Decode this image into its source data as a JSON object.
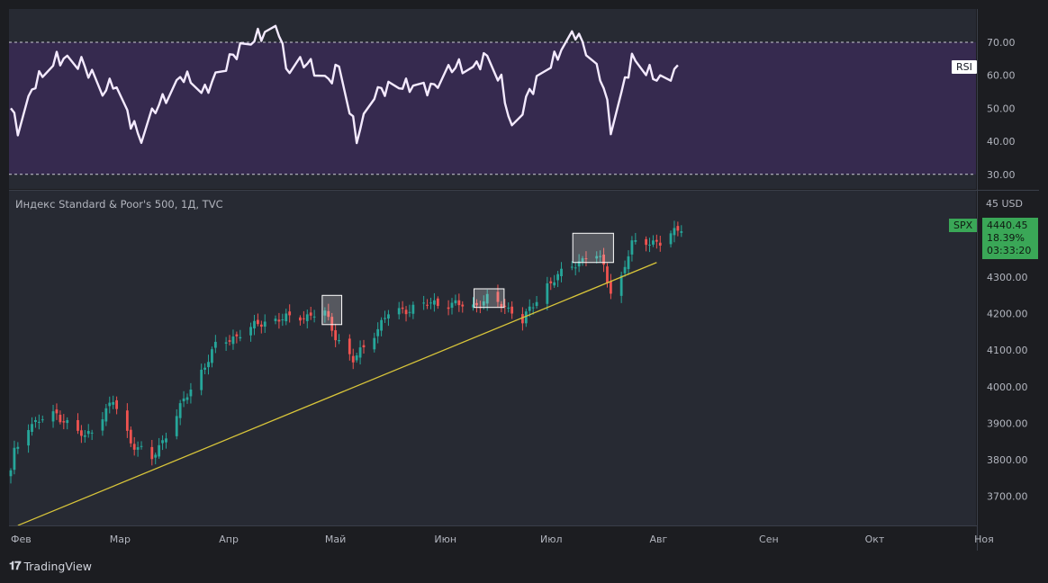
{
  "rsi_pane": {
    "tag": "RSI",
    "ticks": [
      "70.00",
      "60.00",
      "50.00",
      "40.00",
      "30.00"
    ],
    "levels": [
      70,
      30
    ],
    "ylim": [
      25,
      80
    ]
  },
  "price_pane": {
    "title": "Индекс Standard & Poor's 500, 1Д, TVC",
    "currency": "45 USD",
    "ticks": [
      "4300.00",
      "4200.00",
      "4100.00",
      "4000.00",
      "3900.00",
      "3800.00",
      "3700.00"
    ],
    "symbol": "SPX",
    "last_price": "4440.45",
    "change": "18.39%",
    "countdown": "03:33:20"
  },
  "x_axis": {
    "labels": [
      "Фев",
      "Мар",
      "Апр",
      "Май",
      "Июн",
      "Июл",
      "Авг",
      "Сен",
      "Окт",
      "Ноя"
    ]
  },
  "brand": "TradingView",
  "colors": {
    "background": "#1c1d21",
    "pane": "#272a33",
    "rsi_band": "#362a4f",
    "rsi_line": "#f4eaff",
    "up": "#26a69a",
    "down": "#ef5350",
    "trendline": "#d8c53a",
    "price_tag": "#3aa757"
  },
  "chart_data": {
    "type": "candlestick",
    "title": "Индекс Standard & Poor's 500, 1Д, TVC",
    "y_unit": "USD",
    "ylim": [
      3620,
      4470
    ],
    "anchors": [
      {
        "date": "2023-02-01",
        "close": 3765
      },
      {
        "date": "2023-02-02",
        "close": 3820
      },
      {
        "date": "2023-02-06",
        "close": 3895
      },
      {
        "date": "2023-02-14",
        "close": 3925
      },
      {
        "date": "2023-02-22",
        "close": 3860
      },
      {
        "date": "2023-03-02",
        "close": 3960
      },
      {
        "date": "2023-03-07",
        "close": 3850
      },
      {
        "date": "2023-03-13",
        "close": 3800
      },
      {
        "date": "2023-03-22",
        "close": 3960
      },
      {
        "date": "2023-03-31",
        "close": 4110
      },
      {
        "date": "2023-04-14",
        "close": 4180
      },
      {
        "date": "2023-05-01",
        "close": 4200
      },
      {
        "date": "2023-05-04",
        "close": 4140
      },
      {
        "date": "2023-05-09",
        "close": 4070
      },
      {
        "date": "2023-05-19",
        "close": 4200
      },
      {
        "date": "2023-06-01",
        "close": 4230
      },
      {
        "date": "2023-06-12",
        "close": 4220
      },
      {
        "date": "2023-06-16",
        "close": 4240
      },
      {
        "date": "2023-06-23",
        "close": 4210
      },
      {
        "date": "2023-06-26",
        "close": 4180
      },
      {
        "date": "2023-07-03",
        "close": 4280
      },
      {
        "date": "2023-07-10",
        "close": 4330
      },
      {
        "date": "2023-07-16",
        "close": 4370
      },
      {
        "date": "2023-07-19",
        "close": 4330
      },
      {
        "date": "2023-07-21",
        "close": 4260
      },
      {
        "date": "2023-07-24",
        "close": 4300
      },
      {
        "date": "2023-07-27",
        "close": 4390
      },
      {
        "date": "2023-08-01",
        "close": 4400
      },
      {
        "date": "2023-08-04",
        "close": 4390
      },
      {
        "date": "2023-08-10",
        "close": 4440
      }
    ],
    "rsi_anchors": [
      {
        "date": "2023-02-01",
        "rsi": 50
      },
      {
        "date": "2023-02-03",
        "rsi": 44
      },
      {
        "date": "2023-02-08",
        "rsi": 58
      },
      {
        "date": "2023-02-14",
        "rsi": 65
      },
      {
        "date": "2023-02-21",
        "rsi": 64
      },
      {
        "date": "2023-02-27",
        "rsi": 55
      },
      {
        "date": "2023-03-02",
        "rsi": 58
      },
      {
        "date": "2023-03-07",
        "rsi": 46
      },
      {
        "date": "2023-03-10",
        "rsi": 41
      },
      {
        "date": "2023-03-14",
        "rsi": 50
      },
      {
        "date": "2023-03-22",
        "rsi": 60
      },
      {
        "date": "2023-03-28",
        "rsi": 55
      },
      {
        "date": "2023-04-04",
        "rsi": 65
      },
      {
        "date": "2023-04-12",
        "rsi": 72
      },
      {
        "date": "2023-04-18",
        "rsi": 74
      },
      {
        "date": "2023-04-20",
        "rsi": 62
      },
      {
        "date": "2023-04-26",
        "rsi": 64
      },
      {
        "date": "2023-05-02",
        "rsi": 58
      },
      {
        "date": "2023-05-05",
        "rsi": 63
      },
      {
        "date": "2023-05-10",
        "rsi": 41
      },
      {
        "date": "2023-05-15",
        "rsi": 55
      },
      {
        "date": "2023-05-23",
        "rsi": 57
      },
      {
        "date": "2023-05-31",
        "rsi": 56
      },
      {
        "date": "2023-06-07",
        "rsi": 63
      },
      {
        "date": "2023-06-12",
        "rsi": 62
      },
      {
        "date": "2023-06-16",
        "rsi": 66
      },
      {
        "date": "2023-06-20",
        "rsi": 58
      },
      {
        "date": "2023-06-23",
        "rsi": 43
      },
      {
        "date": "2023-06-28",
        "rsi": 55
      },
      {
        "date": "2023-07-05",
        "rsi": 65
      },
      {
        "date": "2023-07-11",
        "rsi": 73
      },
      {
        "date": "2023-07-14",
        "rsi": 68
      },
      {
        "date": "2023-07-19",
        "rsi": 57
      },
      {
        "date": "2023-07-21",
        "rsi": 44
      },
      {
        "date": "2023-07-25",
        "rsi": 58
      },
      {
        "date": "2023-07-27",
        "rsi": 65
      },
      {
        "date": "2023-08-01",
        "rsi": 61
      },
      {
        "date": "2023-08-04",
        "rsi": 58
      },
      {
        "date": "2023-08-09",
        "rsi": 62
      }
    ],
    "trendline": [
      {
        "date": "2023-02-03",
        "price": 3620
      },
      {
        "date": "2023-08-03",
        "price": 4340
      }
    ],
    "boxes": [
      {
        "from": "2023-05-01",
        "to": "2023-05-05",
        "low": 4170,
        "high": 4250
      },
      {
        "from": "2023-06-13",
        "to": "2023-06-20",
        "low": 4217,
        "high": 4268
      },
      {
        "from": "2023-07-11",
        "to": "2023-07-21",
        "low": 4340,
        "high": 4420
      }
    ]
  }
}
